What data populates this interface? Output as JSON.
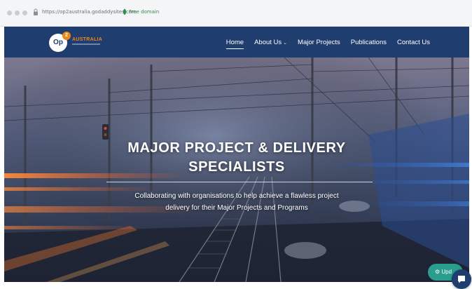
{
  "browser": {
    "url": "https://op2australia.godaddysites.com",
    "domain_tag": "Free domain"
  },
  "logo": {
    "mark": "Op",
    "badge": "2",
    "name": "AUSTRALIA"
  },
  "nav": {
    "items": [
      {
        "label": "Home",
        "active": true
      },
      {
        "label": "About Us",
        "has_dropdown": true
      },
      {
        "label": "Major Projects"
      },
      {
        "label": "Publications"
      },
      {
        "label": "Contact Us"
      }
    ]
  },
  "hero": {
    "title_line1": "MAJOR PROJECT & DELIVERY",
    "title_line2": "SPECIALISTS",
    "subtitle_line1": "Collaborating with organisations to help achieve a flawless project",
    "subtitle_line2": "delivery for their Major Projects and Programs"
  },
  "floating": {
    "update_label": "Upd",
    "update_icon": "gear-icon",
    "chat_icon": "chat-icon"
  },
  "colors": {
    "navbar": "#1f3d6e",
    "accent": "#e88a1a",
    "update_button": "#2a9d8f"
  }
}
